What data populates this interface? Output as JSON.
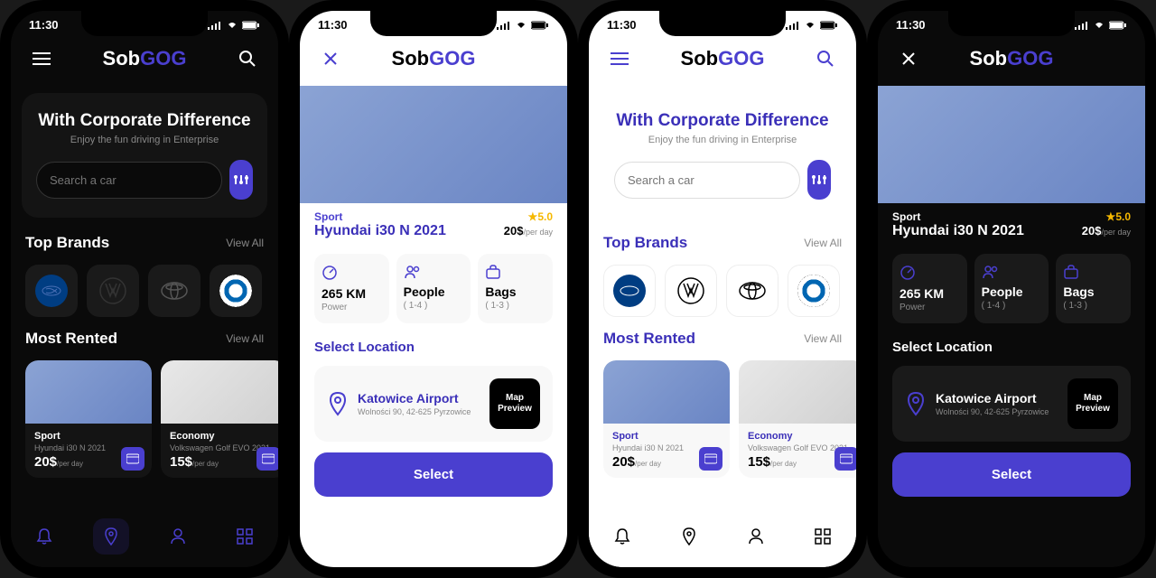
{
  "status": {
    "time": "11:30"
  },
  "brand": {
    "sob": "Sob",
    "gog": "GOG"
  },
  "hero": {
    "title": "With Corporate Difference",
    "subtitle": "Enjoy the fun driving in Enterprise"
  },
  "search": {
    "placeholder": "Search a car"
  },
  "sections": {
    "top_brands": "Top Brands",
    "most_rented": "Most Rented",
    "view_all": "View All"
  },
  "brands": [
    "Hyundai",
    "Volkswagen",
    "Toyota",
    "BMW"
  ],
  "cars": [
    {
      "category": "Sport",
      "model": "Hyundai i30 N 2021",
      "price": "20$",
      "unit": "/per day"
    },
    {
      "category": "Economy",
      "model": "Volkswagen Golf EVO 2021",
      "price": "15$",
      "unit": "/per day"
    }
  ],
  "detail": {
    "category": "Sport",
    "name": "Hyundai i30 N 2021",
    "rating": "5.0",
    "price": "20$",
    "price_unit": "/per day",
    "specs": [
      {
        "value": "265 KM",
        "label": "Power"
      },
      {
        "value": "People",
        "label": "( 1-4 )"
      },
      {
        "value": "Bags",
        "label": "( 1-3 )"
      }
    ],
    "location": {
      "title": "Select Location",
      "name": "Katowice Airport",
      "address": "Wolności 90, 42-625 Pyrzowice",
      "map": "Map Preview"
    },
    "select": "Select"
  }
}
